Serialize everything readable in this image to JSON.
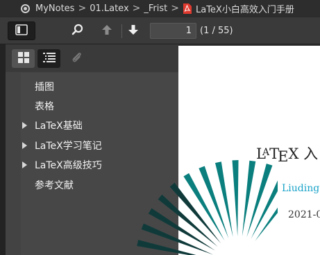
{
  "breadcrumb": {
    "items": [
      "MyNotes",
      "01.Latex",
      "_Frist"
    ],
    "file_name": "LaTeX小白高效入门手册",
    "separator": ">"
  },
  "toolbar": {
    "page_number": "1",
    "page_count_label": "(1 / 55)"
  },
  "outline": {
    "items": [
      {
        "label": "插图",
        "expandable": false
      },
      {
        "label": "表格",
        "expandable": false
      },
      {
        "label": "LaTeX基础",
        "expandable": true
      },
      {
        "label": "LaTeX学习笔记",
        "expandable": true
      },
      {
        "label": "LaTeX高级技巧",
        "expandable": true
      },
      {
        "label": "参考文献",
        "expandable": false
      }
    ]
  },
  "document": {
    "title_text": "入",
    "author_text": "Liuding",
    "date_text": "2021-0"
  },
  "icons": {
    "root": "vault-icon",
    "file": "pdf-file-icon",
    "sidebar_toggle": "sidebar-toggle-icon",
    "search": "search-icon",
    "prev": "arrow-up-icon",
    "next": "arrow-down-icon",
    "thumbnails": "thumbnails-icon",
    "outline": "outline-list-icon",
    "attachments": "paperclip-icon"
  },
  "colors": {
    "accent_teal": "#0a7f7e",
    "author_blue": "#1aa3c9",
    "pdf_red": "#e03a2f"
  }
}
